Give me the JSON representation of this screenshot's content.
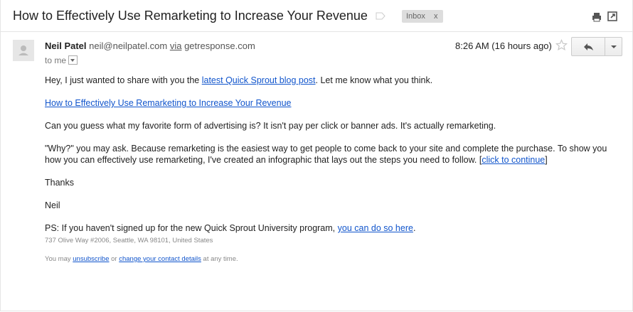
{
  "email": {
    "subject": "How to Effectively Use Remarketing to Increase Your Revenue",
    "label": "Inbox",
    "label_close": "x",
    "sender": {
      "name": "Neil Patel",
      "email": "neil@neilpatel.com",
      "via": "via",
      "domain": "getresponse.com"
    },
    "to": "to me",
    "timestamp": "8:26 AM (16 hours ago)",
    "body": {
      "p1_pre": "Hey, I just wanted to share with you the ",
      "p1_link": "latest Quick Sprout blog post",
      "p1_post": ". Let me know what you think.",
      "p2_link": "How to Effectively Use Remarketing to Increase Your Revenue",
      "p3": "Can you guess what my favorite form of advertising is? It isn't pay per click or banner ads. It's actually remarketing.",
      "p4_pre": "\"Why?\" you may ask. Because remarketing is the easiest way to get people to come back to your site and complete the purchase. To show you how you can effectively use remarketing, I've created an infographic that lays out the steps you need to follow. [",
      "p4_link": "click to continue",
      "p4_post": "]",
      "p5": "Thanks",
      "p6": "Neil",
      "p7_pre": "PS: If you haven't signed up for the new Quick Sprout University program, ",
      "p7_link": "you can do so here",
      "p7_post": ".",
      "address": "737 Olive Way #2006, Seattle, WA 98101, United States"
    },
    "footer": {
      "pre": "You may ",
      "unsubscribe": "unsubscribe",
      "mid": " or ",
      "change": "change your contact details",
      "post": " at any time."
    }
  },
  "icons": {
    "print": "print-icon",
    "new_window": "new-window-icon",
    "star": "star-icon",
    "reply": "reply-icon",
    "more": "chevron-down-icon",
    "label": "label-icon"
  },
  "colors": {
    "link": "#1155cc",
    "label_bg": "#dddddd"
  }
}
